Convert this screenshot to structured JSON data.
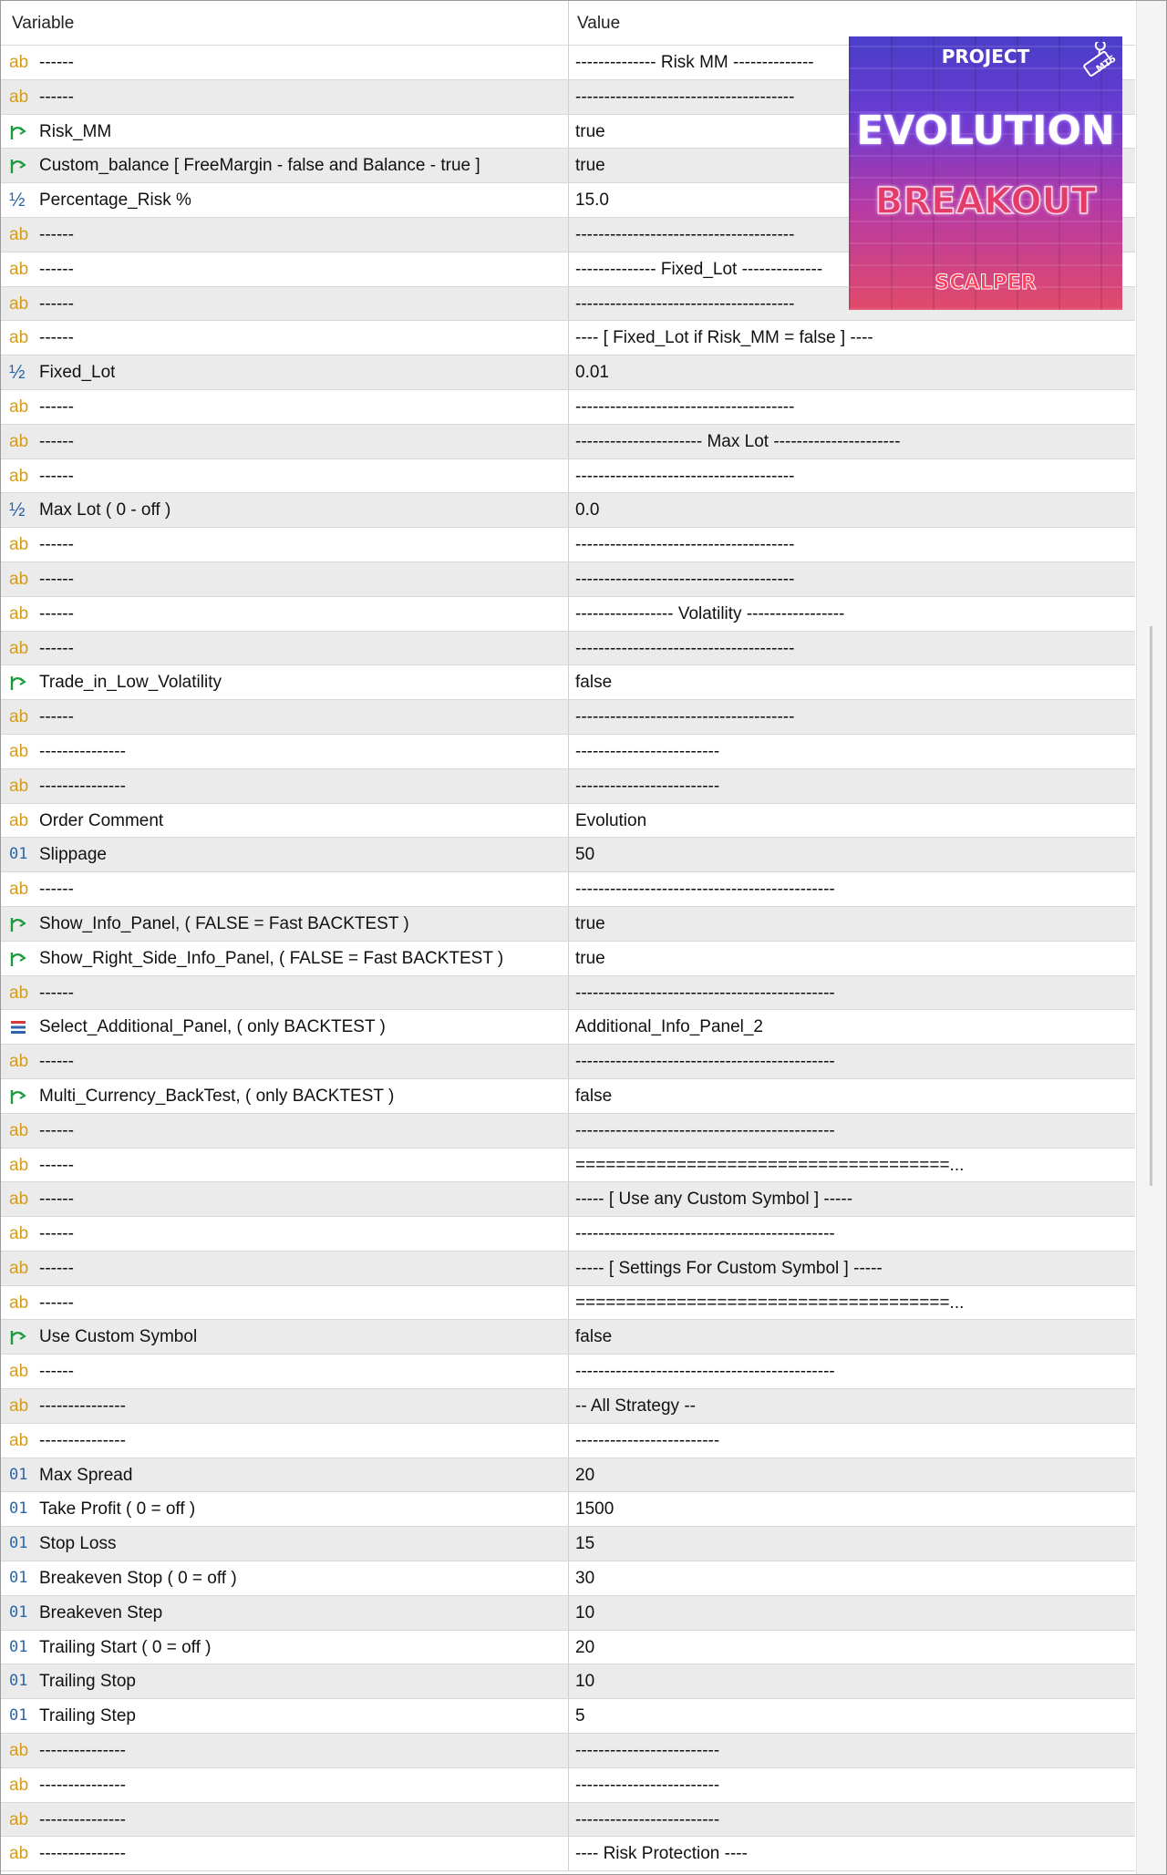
{
  "header": {
    "variable": "Variable",
    "value": "Value"
  },
  "logo": {
    "line1": "PROJECT",
    "line2": "EVOLUTION",
    "line3": "BREAKOUT",
    "line4": "SCALPER",
    "badge": "MT5"
  },
  "rows": [
    {
      "icon": "ab",
      "name": "------",
      "value": "-------------- Risk MM --------------"
    },
    {
      "icon": "ab",
      "name": "------",
      "value": "--------------------------------------"
    },
    {
      "icon": "bool",
      "name": "Risk_MM",
      "value": "true"
    },
    {
      "icon": "bool",
      "name": "Custom_balance [ FreeMargin - false and Balance - true ]",
      "value": "true"
    },
    {
      "icon": "half",
      "name": "Percentage_Risk %",
      "value": "15.0"
    },
    {
      "icon": "ab",
      "name": "------",
      "value": "--------------------------------------"
    },
    {
      "icon": "ab",
      "name": "------",
      "value": "-------------- Fixed_Lot --------------"
    },
    {
      "icon": "ab",
      "name": "------",
      "value": "--------------------------------------"
    },
    {
      "icon": "ab",
      "name": "------",
      "value": "---- [ Fixed_Lot if Risk_MM = false ] ----"
    },
    {
      "icon": "half",
      "name": "Fixed_Lot",
      "value": "0.01"
    },
    {
      "icon": "ab",
      "name": "------",
      "value": "--------------------------------------"
    },
    {
      "icon": "ab",
      "name": "------",
      "value": "---------------------- Max Lot ----------------------"
    },
    {
      "icon": "ab",
      "name": "------",
      "value": "--------------------------------------"
    },
    {
      "icon": "half",
      "name": "Max Lot ( 0 - off )",
      "value": "0.0"
    },
    {
      "icon": "ab",
      "name": "------",
      "value": "--------------------------------------"
    },
    {
      "icon": "ab",
      "name": "------",
      "value": "--------------------------------------"
    },
    {
      "icon": "ab",
      "name": "------",
      "value": "----------------- Volatility -----------------"
    },
    {
      "icon": "ab",
      "name": "------",
      "value": "--------------------------------------"
    },
    {
      "icon": "bool",
      "name": "Trade_in_Low_Volatility",
      "value": "false"
    },
    {
      "icon": "ab",
      "name": "------",
      "value": "--------------------------------------"
    },
    {
      "icon": "ab",
      "name": "---------------",
      "value": "-------------------------"
    },
    {
      "icon": "ab",
      "name": "---------------",
      "value": "-------------------------"
    },
    {
      "icon": "ab",
      "name": "Order Comment",
      "value": "Evolution"
    },
    {
      "icon": "01",
      "name": "Slippage",
      "value": "50"
    },
    {
      "icon": "ab",
      "name": "------",
      "value": "---------------------------------------------"
    },
    {
      "icon": "bool",
      "name": "Show_Info_Panel, ( FALSE = Fast BACKTEST )",
      "value": "true"
    },
    {
      "icon": "bool",
      "name": "Show_Right_Side_Info_Panel, ( FALSE = Fast BACKTEST )",
      "value": "true"
    },
    {
      "icon": "ab",
      "name": "------",
      "value": "---------------------------------------------"
    },
    {
      "icon": "enum",
      "name": "Select_Additional_Panel, ( only BACKTEST )",
      "value": "Additional_Info_Panel_2"
    },
    {
      "icon": "ab",
      "name": "------",
      "value": "---------------------------------------------"
    },
    {
      "icon": "bool",
      "name": "Multi_Currency_BackTest, ( only BACKTEST )",
      "value": "false"
    },
    {
      "icon": "ab",
      "name": "------",
      "value": "---------------------------------------------"
    },
    {
      "icon": "ab",
      "name": "------",
      "value": "=====================================..."
    },
    {
      "icon": "ab",
      "name": "------",
      "value": "----- [ Use any Custom Symbol ] -----"
    },
    {
      "icon": "ab",
      "name": "------",
      "value": "---------------------------------------------"
    },
    {
      "icon": "ab",
      "name": "------",
      "value": "----- [ Settings For Custom Symbol ] -----"
    },
    {
      "icon": "ab",
      "name": "------",
      "value": "=====================================..."
    },
    {
      "icon": "bool",
      "name": "Use Custom Symbol",
      "value": "false"
    },
    {
      "icon": "ab",
      "name": "------",
      "value": "---------------------------------------------"
    },
    {
      "icon": "ab",
      "name": "---------------",
      "value": "-- All Strategy --"
    },
    {
      "icon": "ab",
      "name": "---------------",
      "value": "-------------------------"
    },
    {
      "icon": "01",
      "name": "Max Spread",
      "value": "20"
    },
    {
      "icon": "01",
      "name": "Take Profit ( 0 = off )",
      "value": "1500"
    },
    {
      "icon": "01",
      "name": "Stop Loss",
      "value": "15"
    },
    {
      "icon": "01",
      "name": "Breakeven Stop ( 0 = off )",
      "value": "30"
    },
    {
      "icon": "01",
      "name": "Breakeven Step",
      "value": "10"
    },
    {
      "icon": "01",
      "name": "Trailing Start ( 0 = off )",
      "value": "20"
    },
    {
      "icon": "01",
      "name": "Trailing Stop",
      "value": "10"
    },
    {
      "icon": "01",
      "name": "Trailing Step",
      "value": "5"
    },
    {
      "icon": "ab",
      "name": "---------------",
      "value": "-------------------------"
    },
    {
      "icon": "ab",
      "name": "---------------",
      "value": "-------------------------"
    },
    {
      "icon": "ab",
      "name": "---------------",
      "value": "-------------------------"
    },
    {
      "icon": "ab",
      "name": "---------------",
      "value": "---- Risk Protection ----"
    }
  ]
}
